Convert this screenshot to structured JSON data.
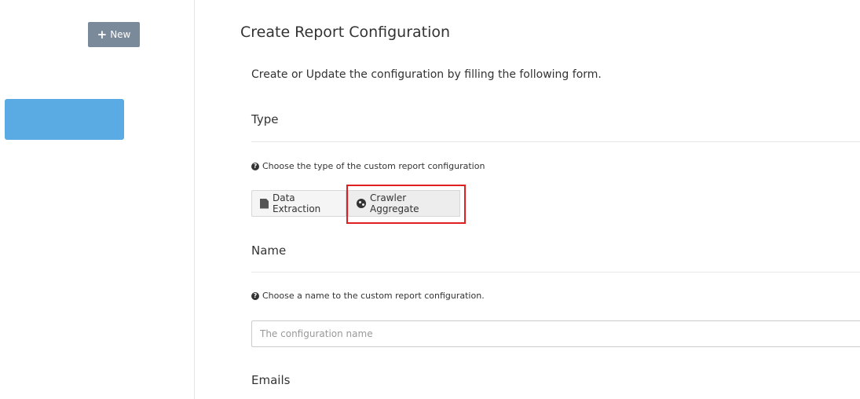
{
  "sidebar": {
    "new_button": {
      "label": "New",
      "icon": "plus-icon"
    }
  },
  "main": {
    "title": "Create Report Configuration",
    "description": "Create or Update the configuration by filling the following form.",
    "type_section": {
      "title": "Type",
      "help": "Choose the type of the custom report configuration",
      "options": [
        {
          "label": "Data Extraction",
          "icon": "file-icon"
        },
        {
          "label": "Crawler Aggregate",
          "icon": "globe-icon",
          "selected": true
        }
      ]
    },
    "name_section": {
      "title": "Name",
      "help": "Choose a name to the custom report configuration.",
      "input": {
        "placeholder": "The configuration name",
        "value": ""
      }
    },
    "emails_section": {
      "title": "Emails"
    }
  },
  "colors": {
    "new_button_bg": "#7b8a9a",
    "sidebar_active": "#5aaae4",
    "highlight_border": "#e02020"
  }
}
